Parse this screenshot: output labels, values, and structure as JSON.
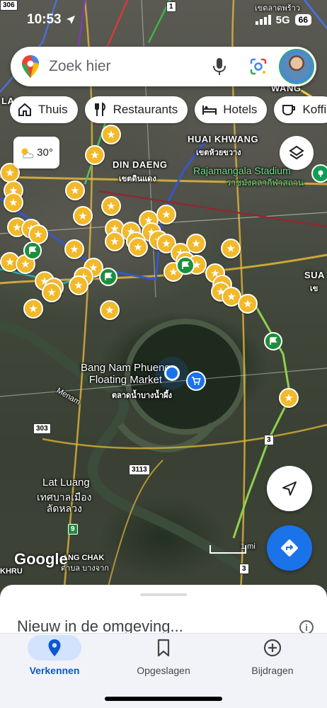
{
  "status_bar": {
    "time": "10:53",
    "network": "5G",
    "battery": "66"
  },
  "search": {
    "placeholder": "Zoek hier"
  },
  "chips": [
    {
      "label": "Thuis",
      "icon": "home-icon"
    },
    {
      "label": "Restaurants",
      "icon": "restaurant-icon"
    },
    {
      "label": "Hotels",
      "icon": "hotel-icon"
    },
    {
      "label": "Koffi",
      "icon": "coffee-icon"
    }
  ],
  "weather": {
    "temperature": "30°",
    "icon": "partly-cloudy-icon"
  },
  "map": {
    "labels": {
      "din_daeng": "DIN DAENG",
      "din_daeng_th": "เขตดินแดง",
      "huai_khwang": "HUAI KHWANG",
      "huai_khwang_th": "เขตห้วยขวาง",
      "stadium": "Rajamangala Stadium",
      "stadium_th": "ราชมังคลากีฬาสถาน",
      "market": "Bang Nam Phueng\nFloating Market",
      "market_th": "ตลาดน้ำบางน้ำผึ้ง",
      "lat_luang": "Lat Luang",
      "lat_luang_th": "เทศบาลเมือง\nลัดหลวง",
      "menam": "Menam",
      "bang_chak": "ANG CHAK",
      "bang_chak_th": "ตำบล บางจาก",
      "khru": "KHRU",
      "top_right_th": "เขตลาดพร้าว",
      "wang": "WANG",
      "sua": "SUA",
      "sua_th": "เข",
      "la": "LA",
      "scale": "1 mi"
    },
    "road_shields": [
      "306",
      "1",
      "303",
      "3113",
      "3",
      "9",
      "3"
    ],
    "google_watermark": "Google"
  },
  "bottom_sheet": {
    "title": "Nieuw in de omgeving..."
  },
  "nav": [
    {
      "label": "Verkennen",
      "icon": "explore-pin-icon",
      "active": true
    },
    {
      "label": "Opgeslagen",
      "icon": "bookmark-icon",
      "active": false
    },
    {
      "label": "Bijdragen",
      "icon": "add-circle-icon",
      "active": false
    }
  ],
  "colors": {
    "accent": "#1a73e8",
    "star_pin": "#f2b92a",
    "flag_pin": "#1e8e3e",
    "nav_active_bg": "#d3e3fd"
  }
}
